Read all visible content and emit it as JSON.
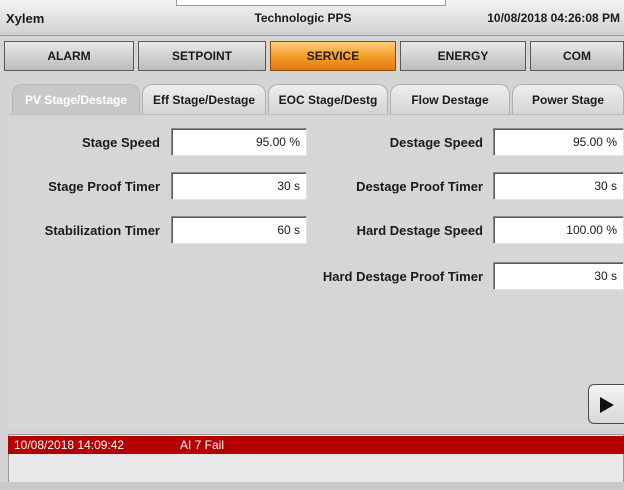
{
  "header": {
    "brand": "Xylem",
    "app_title": "Technologic PPS",
    "datetime": "10/08/2018 04:26:08 PM"
  },
  "main_nav": [
    {
      "label": "ALARM",
      "active": false
    },
    {
      "label": "SETPOINT",
      "active": false
    },
    {
      "label": "SERVICE",
      "active": true
    },
    {
      "label": "ENERGY",
      "active": false
    },
    {
      "label": "COM",
      "active": false
    }
  ],
  "sub_tabs": [
    {
      "label": "PV Stage/Destage",
      "active": true
    },
    {
      "label": "Eff Stage/Destage",
      "active": false
    },
    {
      "label": "EOC Stage/Destg",
      "active": false
    },
    {
      "label": "Flow Destage",
      "active": false
    },
    {
      "label": "Power Stage",
      "active": false
    }
  ],
  "settings": {
    "stage_speed": {
      "label": "Stage Speed",
      "value": "95.00 %"
    },
    "stage_proof_timer": {
      "label": "Stage Proof Timer",
      "value": "30 s"
    },
    "stabilization_timer": {
      "label": "Stabilization Timer",
      "value": "60 s"
    },
    "destage_speed": {
      "label": "Destage Speed",
      "value": "95.00 %"
    },
    "destage_proof_timer": {
      "label": "Destage Proof Timer",
      "value": "30 s"
    },
    "hard_destage_speed": {
      "label": "Hard Destage Speed",
      "value": "100.00 %"
    },
    "hard_destage_proof_timer": {
      "label": "Hard Destage Proof Timer",
      "value": "30 s"
    }
  },
  "next_button": {
    "icon": "play-right-icon"
  },
  "alarm": {
    "timestamp": "10/08/2018 14:09:42",
    "message": "AI 7 Fail",
    "color": "#b40000"
  },
  "colors": {
    "active_tab": "#f29a26",
    "alarm": "#b40000"
  }
}
